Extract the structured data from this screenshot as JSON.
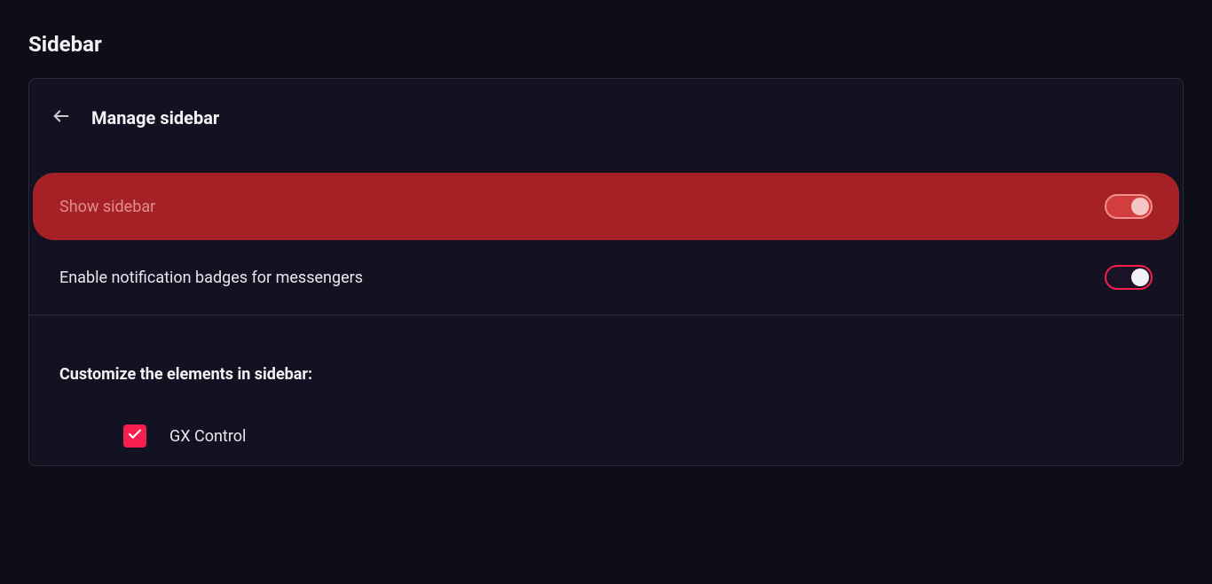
{
  "section_title": "Sidebar",
  "panel": {
    "title": "Manage sidebar",
    "rows": {
      "show_sidebar": {
        "label": "Show sidebar",
        "on": true
      },
      "enable_badges": {
        "label": "Enable notification badges for messengers",
        "on": true
      }
    },
    "customize": {
      "title": "Customize the elements in sidebar:",
      "items": [
        {
          "label": "GX Control",
          "checked": true
        }
      ]
    }
  }
}
